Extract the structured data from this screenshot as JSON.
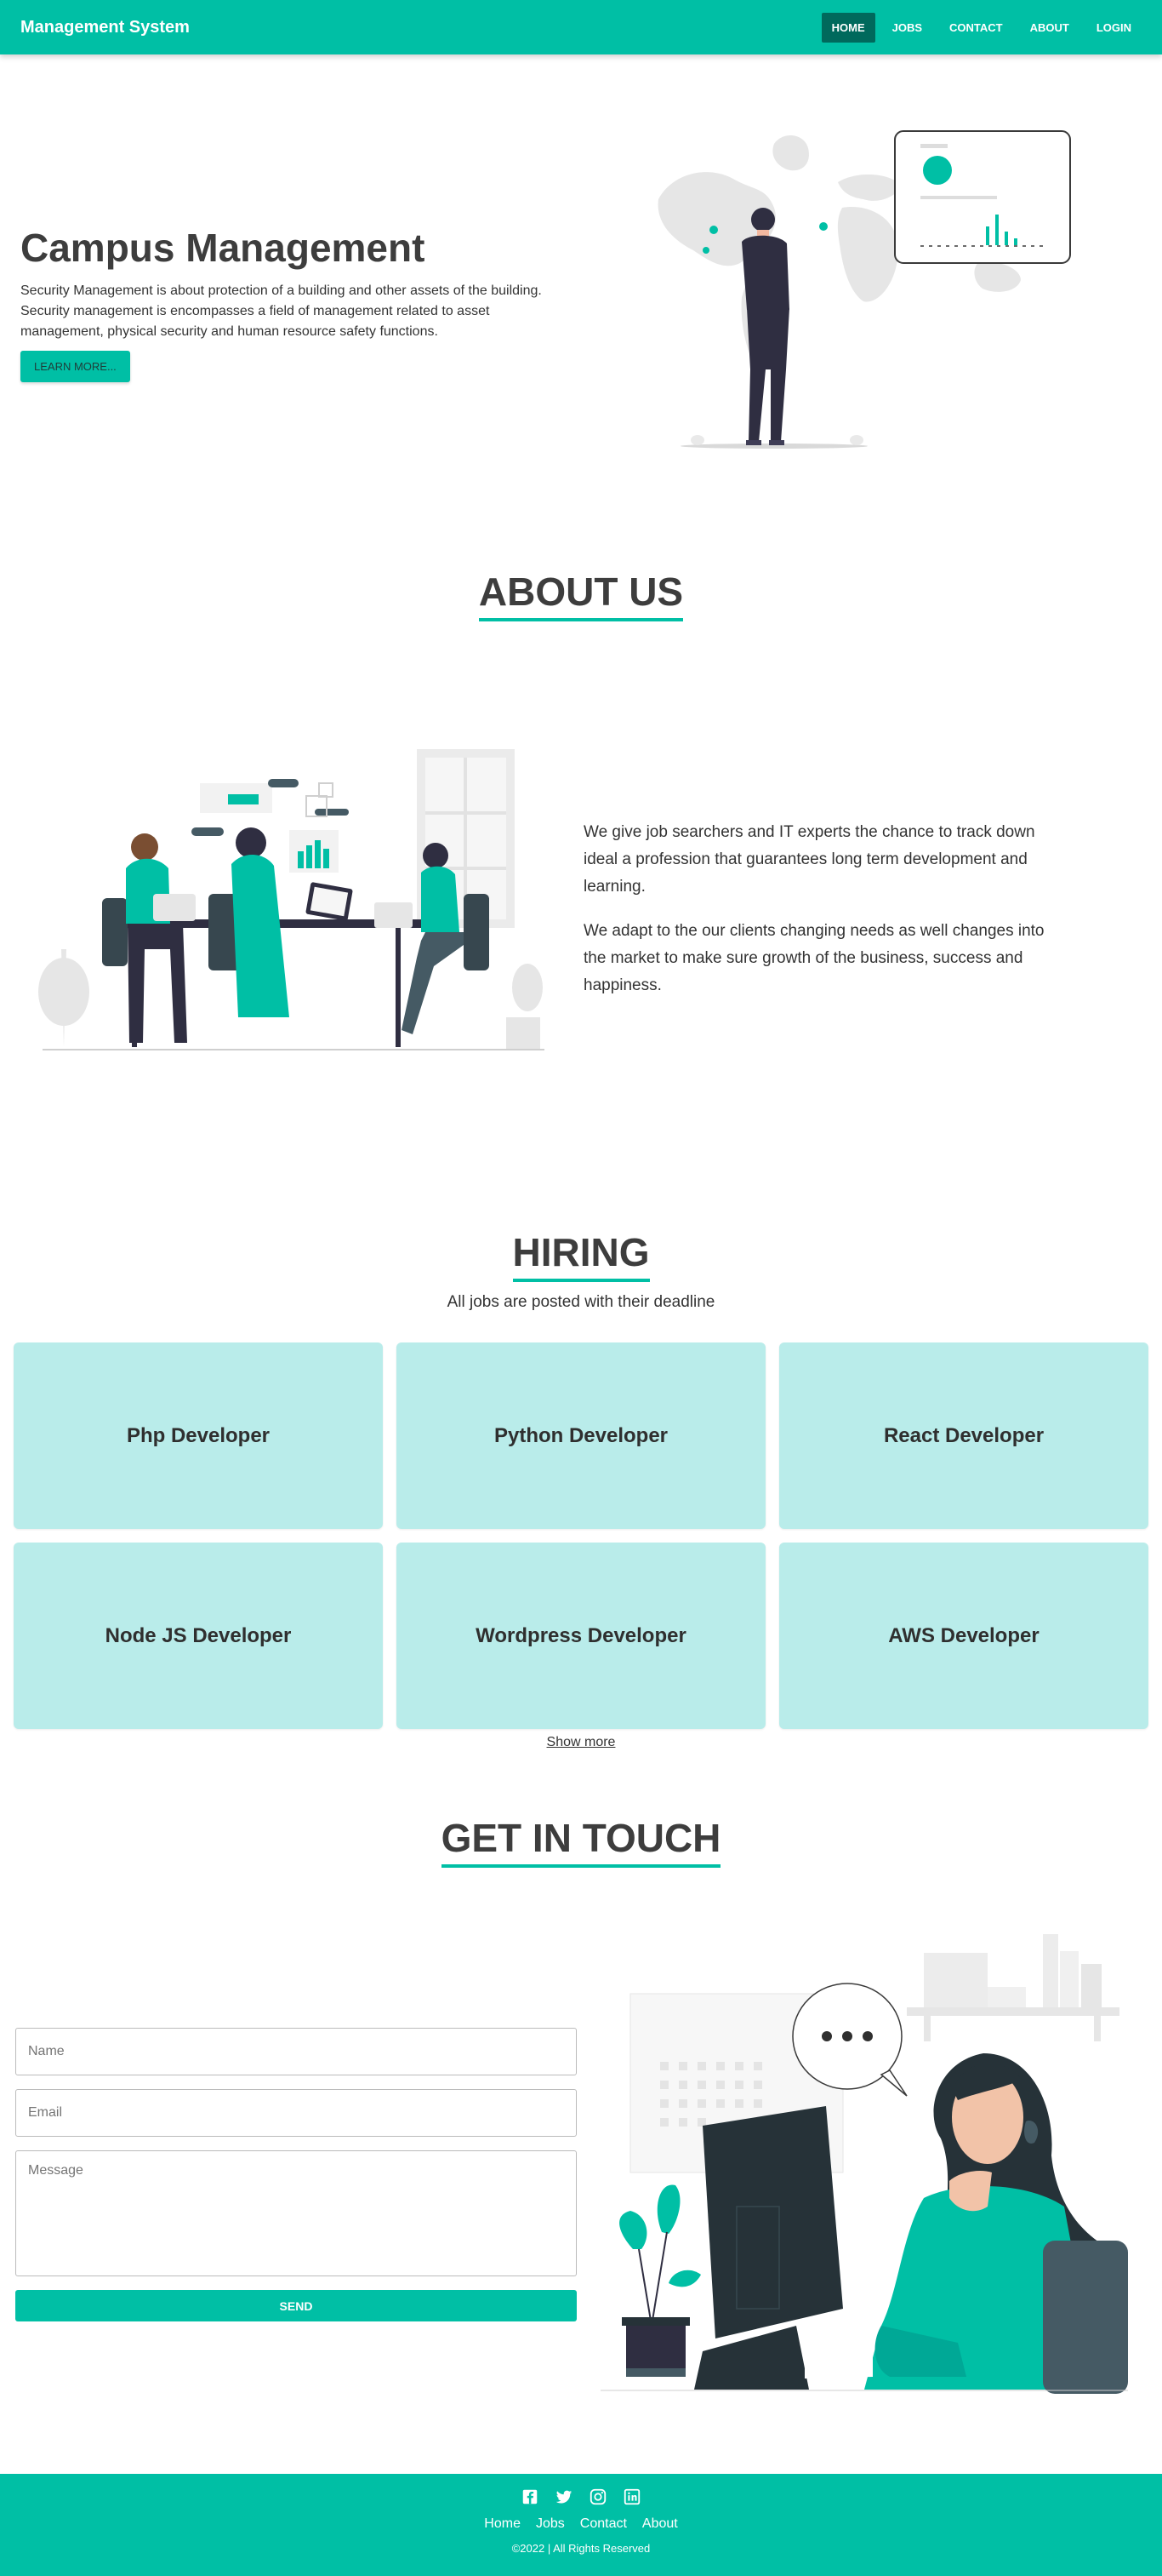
{
  "nav": {
    "brand": "Management System",
    "links": [
      "HOME",
      "JOBS",
      "CONTACT",
      "ABOUT",
      "LOGIN"
    ]
  },
  "hero": {
    "title": "Campus Management",
    "description": "Security Management is about protection of a building and other assets of the building. Security management is encompasses a field of management related to asset management, physical security and human resource safety functions.",
    "button": "LEARN MORE..."
  },
  "about": {
    "title": "ABOUT US",
    "paragraphs": [
      "We give job searchers and IT experts the chance to track down ideal a profession that guarantees long term development and learning.",
      "We adapt to the our clients changing needs as well changes into the market to make sure growth of the business, success and happiness."
    ]
  },
  "hiring": {
    "title": "HIRING",
    "subtitle": "All jobs are posted with their deadline",
    "jobs": [
      "Php Developer",
      "Python Developer",
      "React Developer",
      "Node JS Developer",
      "Wordpress Developer",
      "AWS Developer"
    ],
    "show_more": "Show more"
  },
  "contact": {
    "title": "GET IN TOUCH",
    "name_placeholder": "Name",
    "email_placeholder": "Email",
    "message_placeholder": "Message",
    "send": "SEND"
  },
  "footer": {
    "social": [
      "facebook-icon",
      "twitter-icon",
      "instagram-icon",
      "linkedin-icon"
    ],
    "links": [
      "Home",
      "Jobs",
      "Contact",
      "About"
    ],
    "copyright": "©2022  |  All Rights Reserved"
  },
  "colors": {
    "accent": "#00bfa5",
    "active_nav": "#00695c",
    "card": "#b9ecea"
  }
}
